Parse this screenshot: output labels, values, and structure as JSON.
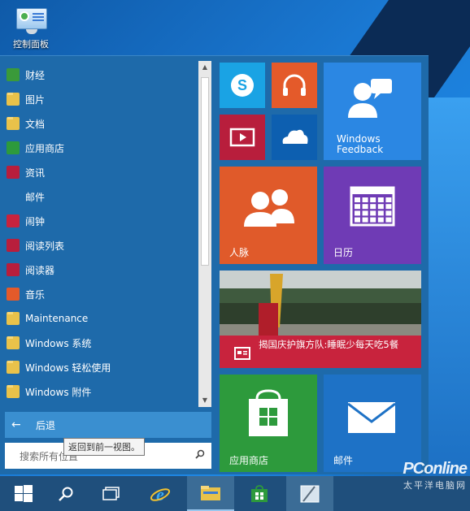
{
  "desktop": {
    "control_panel_label": "控制面板"
  },
  "app_list": [
    {
      "label": "财经",
      "icon": "finance-icon",
      "color": "#3a9a3a"
    },
    {
      "label": "图片",
      "icon": "folder-icon",
      "color": "#e9c24a"
    },
    {
      "label": "文档",
      "icon": "folder-icon",
      "color": "#e9c24a"
    },
    {
      "label": "应用商店",
      "icon": "store-icon",
      "color": "#2d9a3c"
    },
    {
      "label": "资讯",
      "icon": "news-icon",
      "color": "#b81e3c"
    },
    {
      "label": "邮件",
      "icon": "mail-icon",
      "color": "#1e6aaa"
    },
    {
      "label": "闹钟",
      "icon": "alarm-icon",
      "color": "#c8233d"
    },
    {
      "label": "阅读列表",
      "icon": "reading-list-icon",
      "color": "#b81e3c"
    },
    {
      "label": "阅读器",
      "icon": "reader-icon",
      "color": "#b81e3c"
    },
    {
      "label": "音乐",
      "icon": "music-icon",
      "color": "#e45a2a"
    },
    {
      "label": "Maintenance",
      "icon": "folder-icon",
      "color": "#e9c24a"
    },
    {
      "label": "Windows 系统",
      "icon": "folder-icon",
      "color": "#e9c24a"
    },
    {
      "label": "Windows 轻松使用",
      "icon": "folder-icon",
      "color": "#e9c24a"
    },
    {
      "label": "Windows 附件",
      "icon": "folder-icon",
      "color": "#e9c24a"
    }
  ],
  "back": {
    "label": "后退",
    "tooltip": "返回到前一视图。"
  },
  "search": {
    "placeholder": "搜索所有位置"
  },
  "tiles": {
    "feedback": {
      "line1": "Windows",
      "line2": "Feedback"
    },
    "people": {
      "label": "人脉"
    },
    "calendar": {
      "label": "日历"
    },
    "news": {
      "headline": "揭国庆护旗方队:睡眠少每天吃5餐"
    },
    "store": {
      "label": "应用商店"
    },
    "mail": {
      "label": "邮件"
    }
  },
  "colors": {
    "skype": "#1aa3e4",
    "music": "#e45a2a",
    "video": "#b81e3c",
    "onedrive": "#0d5fb0",
    "feedback": "#2b87e3",
    "people": "#e05a2a",
    "calendar": "#6f3bb5",
    "news_bar": "#c8233d",
    "store": "#2d9a3c",
    "mail": "#1e72c6"
  },
  "watermark": {
    "line1": "PConline",
    "line2": "太平洋电脑网"
  }
}
